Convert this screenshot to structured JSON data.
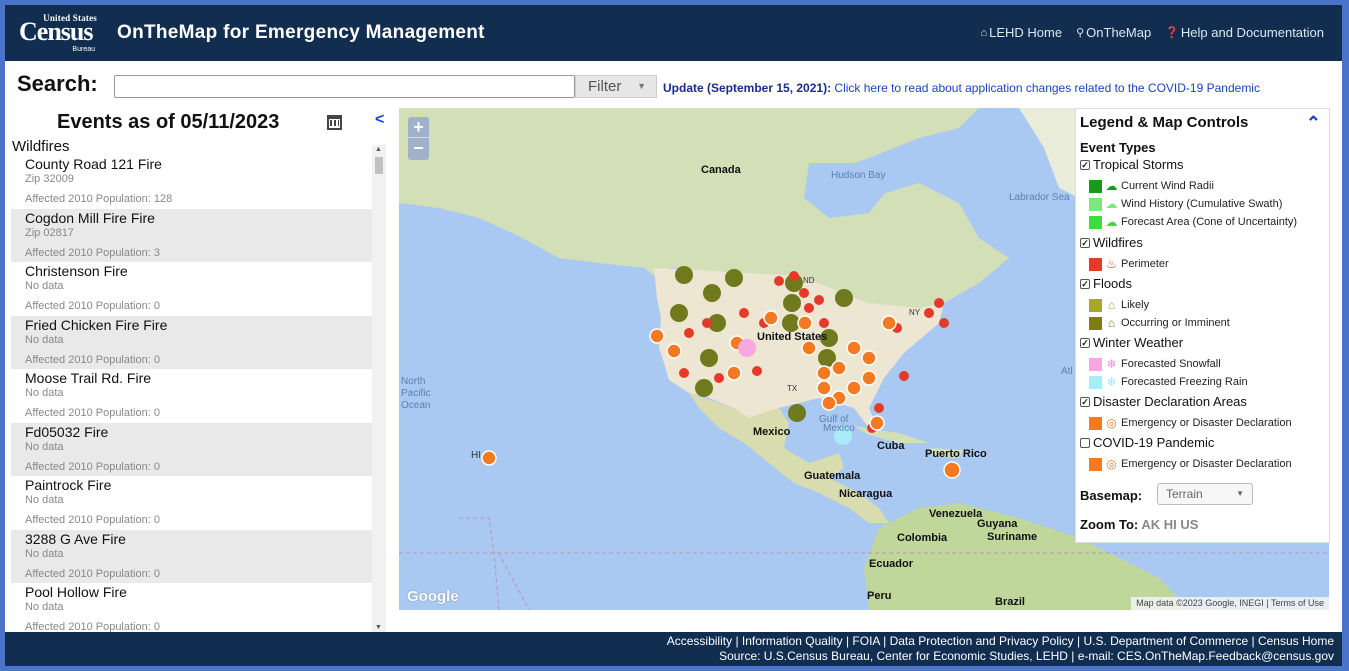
{
  "header": {
    "logo_top": "United States",
    "logo_main": "Census",
    "logo_bottom": "Bureau",
    "title": "OnTheMap for Emergency Management",
    "links": [
      "LEHD Home",
      "OnTheMap",
      "Help and Documentation"
    ]
  },
  "search": {
    "label": "Search:",
    "value": "",
    "filter_label": "Filter",
    "update_bold": "Update (September 15, 2021):",
    "update_text": " Click here to read about application changes related to the COVID-19 Pandemic"
  },
  "sidebar": {
    "title": "Events as of 05/11/2023",
    "collapse": "<",
    "category": "Wildfires",
    "events": [
      {
        "name": "County Road 121 Fire",
        "zip": "Zip 32009",
        "pop": "Affected 2010 Population: 128"
      },
      {
        "name": "Cogdon Mill Fire Fire",
        "zip": "Zip 02817",
        "pop": "Affected 2010 Population: 3"
      },
      {
        "name": "Christenson Fire",
        "zip": "No data",
        "pop": "Affected 2010 Population: 0"
      },
      {
        "name": "Fried Chicken Fire Fire",
        "zip": "No data",
        "pop": "Affected 2010 Population: 0"
      },
      {
        "name": "Moose Trail Rd. Fire",
        "zip": "No data",
        "pop": "Affected 2010 Population: 0"
      },
      {
        "name": "Fd05032 Fire",
        "zip": "No data",
        "pop": "Affected 2010 Population: 0"
      },
      {
        "name": "Paintrock Fire",
        "zip": "No data",
        "pop": "Affected 2010 Population: 0"
      },
      {
        "name": "3288 G Ave Fire",
        "zip": "No data",
        "pop": "Affected 2010 Population: 0"
      },
      {
        "name": "Pool Hollow Fire",
        "zip": "No data",
        "pop": "Affected 2010 Population: 0"
      }
    ]
  },
  "map": {
    "labels": [
      "Canada",
      "Hudson Bay",
      "Labrador Sea",
      "United States",
      "North",
      "Pacific",
      "Ocean",
      "Mexico",
      "Gulf of",
      "Mexico",
      "Cuba",
      "Puerto Rico",
      "Guatemala",
      "Nicaragua",
      "Venezuela",
      "Guyana",
      "Suriname",
      "Colombia",
      "Ecuador",
      "Peru",
      "Brazil",
      "HI",
      "ND",
      "NY",
      "TX",
      "Atl"
    ],
    "zoom_in": "+",
    "zoom_out": "−",
    "google": "Google",
    "attribution_data": "Map data ©2023 Google, INEGI",
    "attribution_terms": "Terms of Use",
    "colors": {
      "ocean": "#a9c9f2",
      "land": "#c8dcae",
      "us_land": "#e9e4d6",
      "fire": "#e53a2a",
      "flood": "#6f7a1c",
      "disaster": "#f47a22",
      "snow": "#f48cd6",
      "rain": "#9fe8f7"
    }
  },
  "legend": {
    "title": "Legend & Map Controls",
    "collapse": "^",
    "event_types": "Event Types",
    "categories": [
      {
        "label": "Tropical Storms",
        "checked": true,
        "items": [
          {
            "label": "Current Wind Radii",
            "color": "#1a9a1a",
            "glyph": "storm-icon"
          },
          {
            "label": "Wind History (Cumulative Swath)",
            "color": "#7de87d",
            "glyph": "storm-icon"
          },
          {
            "label": "Forecast Area (Cone of Uncertainty)",
            "color": "#3fdc3f",
            "glyph": "storm-icon"
          }
        ]
      },
      {
        "label": "Wildfires",
        "checked": true,
        "items": [
          {
            "label": "Perimeter",
            "color": "#e53a2a",
            "glyph": "flame-icon"
          }
        ]
      },
      {
        "label": "Floods",
        "checked": true,
        "items": [
          {
            "label": "Likely",
            "color": "#a7a728",
            "glyph": "house-flood-icon"
          },
          {
            "label": "Occurring or Imminent",
            "color": "#7d7d10",
            "glyph": "house-flood-icon"
          }
        ]
      },
      {
        "label": "Winter Weather",
        "checked": true,
        "items": [
          {
            "label": "Forecasted Snowfall",
            "color": "#f7a8e0",
            "glyph": "snowflake-icon"
          },
          {
            "label": "Forecasted Freezing Rain",
            "color": "#a7ecf7",
            "glyph": "snowflake-icon"
          }
        ]
      },
      {
        "label": "Disaster Declaration Areas",
        "checked": true,
        "items": [
          {
            "label": "Emergency or Disaster Declaration",
            "color": "#f47a22",
            "glyph": "lifebuoy-icon"
          }
        ]
      },
      {
        "label": "COVID-19 Pandemic",
        "checked": false,
        "items": [
          {
            "label": "Emergency or Disaster Declaration",
            "color": "#f47a22",
            "glyph": "lifebuoy-icon"
          }
        ]
      }
    ],
    "basemap_label": "Basemap:",
    "basemap_value": "Terrain",
    "zoom_to_label": "Zoom To:",
    "zoom_to_options": [
      "AK",
      "HI",
      "US"
    ]
  },
  "footer": {
    "links": [
      "Accessibility",
      "Information Quality",
      "FOIA",
      "Data Protection and Privacy Policy",
      "U.S. Department of Commerce",
      "Census Home"
    ],
    "source": "Source: U.S.Census Bureau, Center for Economic Studies, LEHD | e-mail: CES.OnTheMap.Feedback@census.gov"
  }
}
